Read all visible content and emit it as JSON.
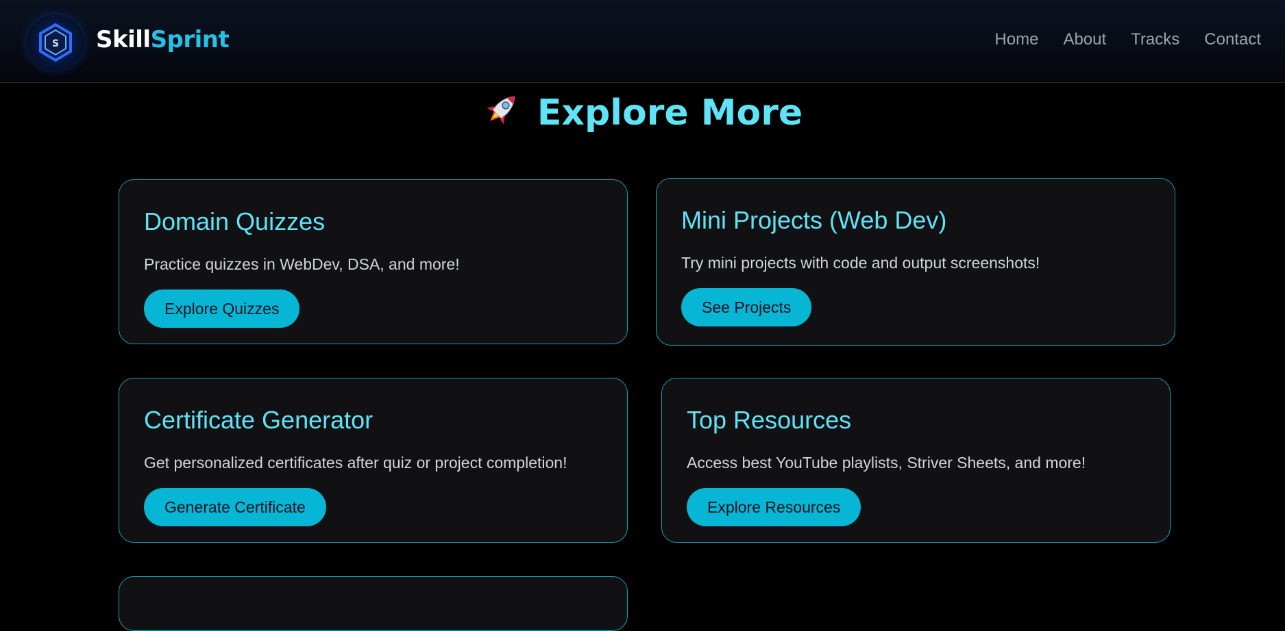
{
  "brand": {
    "name_part1": "Skill",
    "name_part2": "Sprint",
    "logo_letter": "S"
  },
  "nav": {
    "items": [
      {
        "label": "Home"
      },
      {
        "label": "About"
      },
      {
        "label": "Tracks"
      },
      {
        "label": "Contact"
      }
    ]
  },
  "page": {
    "title": "Explore More",
    "title_icon": "rocket-icon"
  },
  "cards": [
    {
      "title": "Domain Quizzes",
      "description": "Practice quizzes in WebDev, DSA, and more!",
      "button": "Explore Quizzes"
    },
    {
      "title": "Mini Projects (Web Dev)",
      "description": "Try mini projects with code and output screenshots!",
      "button": "See Projects"
    },
    {
      "title": "Certificate Generator",
      "description": "Get personalized certificates after quiz or project completion!",
      "button": "Generate Certificate"
    },
    {
      "title": "Top Resources",
      "description": "Access best YouTube playlists, Striver Sheets, and more!",
      "button": "Explore Resources"
    }
  ],
  "colors": {
    "accent": "#22c3e6",
    "title": "#5fe3f6",
    "button": "#06b6d4",
    "card_border": "#1a9fb8",
    "background": "#000000"
  }
}
